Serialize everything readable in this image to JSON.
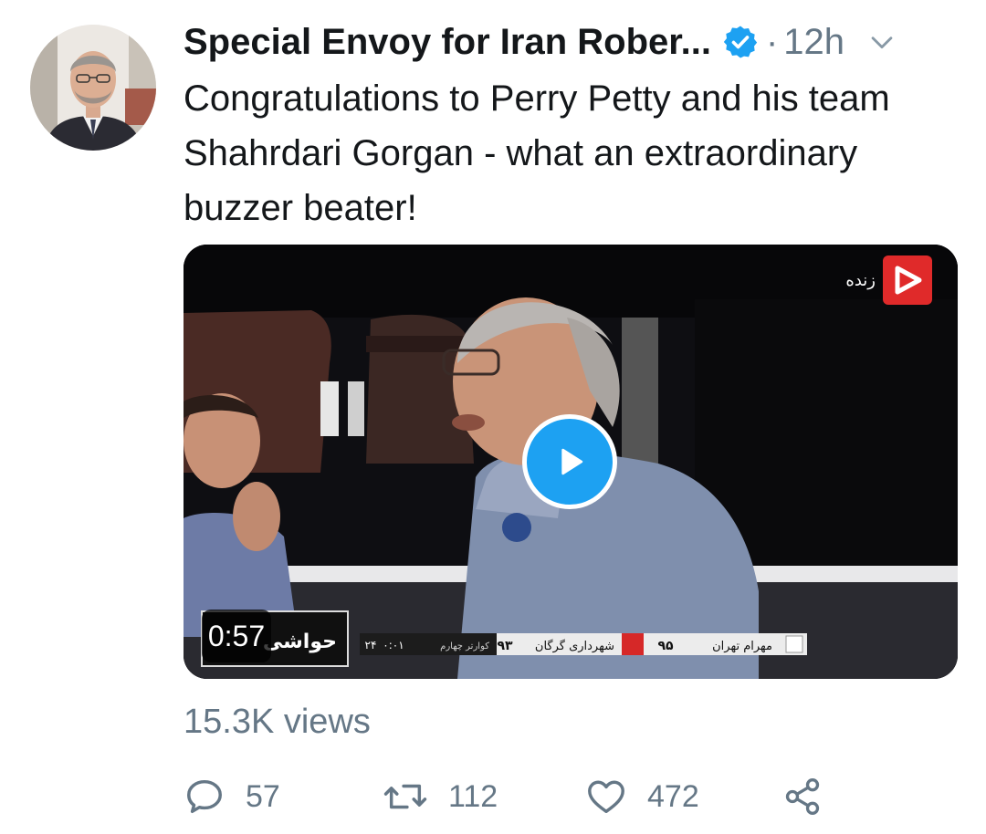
{
  "tweet": {
    "author_name": "Special Envoy for Iran Rober...",
    "separator": "·",
    "time": "12h",
    "text": "Congratulations to Perry Petty and his team Shahrdari Gorgan - what an extraordinary buzzer beater!"
  },
  "video": {
    "duration": "0:57",
    "channel_label": "زنده",
    "caption_label": "حواشی",
    "score_home": "مهرام تهران",
    "score_home_points": "۹۵",
    "score_away": "شهرداری گرگان",
    "score_away_points": "۹۳",
    "period": "کوارتر چهارم",
    "clock": "۰:۰۱",
    "shot_clock": "۲۴"
  },
  "stats": {
    "views": "15.3K views",
    "replies": "57",
    "retweets": "112",
    "likes": "472"
  },
  "colors": {
    "accent": "#1da1f2",
    "text": "#14171a",
    "secondary": "#657786"
  },
  "icons": [
    "verified-badge-icon",
    "chevron-down-icon",
    "play-icon",
    "reply-icon",
    "retweet-icon",
    "like-icon",
    "share-icon"
  ]
}
